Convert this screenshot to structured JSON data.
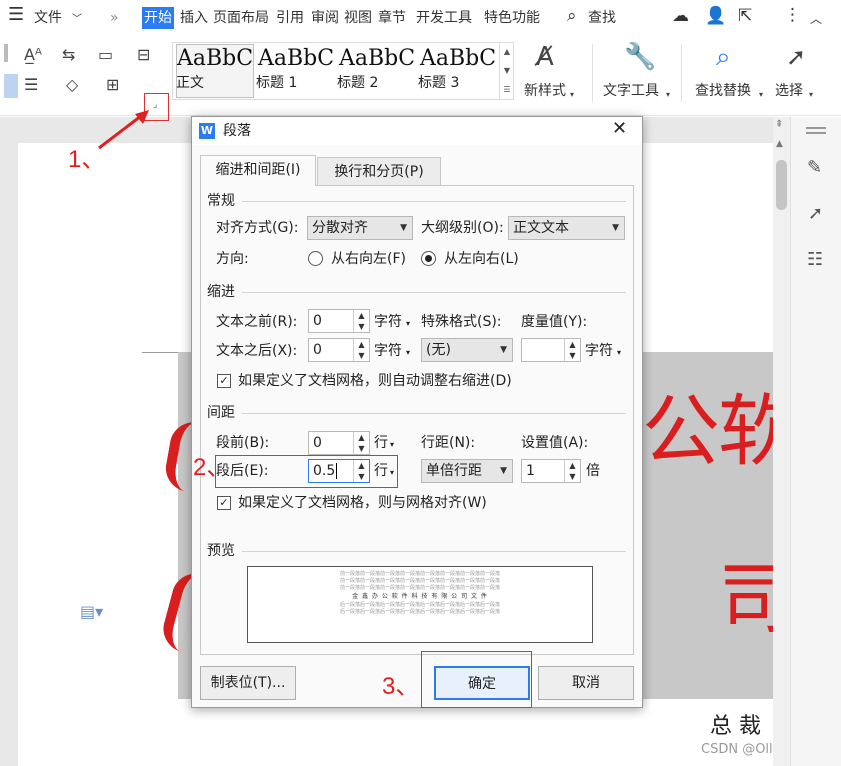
{
  "menubar": {
    "file": "文件",
    "tabs": [
      "开始",
      "插入",
      "页面布局",
      "引用",
      "审阅",
      "视图",
      "章节",
      "开发工具",
      "特色功能"
    ],
    "search": "查找"
  },
  "ribbon": {
    "styles": [
      {
        "sample": "AaBbC",
        "label": "正文"
      },
      {
        "sample": "AaBbC",
        "label": "标题 1"
      },
      {
        "sample": "AaBbC",
        "label": "标题 2"
      },
      {
        "sample": "AaBbC",
        "label": "标题 3"
      }
    ],
    "new_style": "新样式",
    "text_tools": "文字工具",
    "find_replace": "查找替换",
    "select": "选择"
  },
  "document": {
    "red_chars": [
      "软",
      "公",
      "司"
    ],
    "signature": "总 裁",
    "watermark": "CSDN @Oll Correct"
  },
  "dialog": {
    "title": "段落",
    "tabs": [
      "缩进和间距(I)",
      "换行和分页(P)"
    ],
    "general": {
      "heading": "常规",
      "align_label": "对齐方式(G):",
      "align_value": "分散对齐",
      "outline_label": "大纲级别(O):",
      "outline_value": "正文文本",
      "direction_label": "方向:",
      "rtl_label": "从右向左(F)",
      "ltr_label": "从左向右(L)"
    },
    "indent": {
      "heading": "缩进",
      "before_label": "文本之前(R):",
      "before_value": "0",
      "after_label": "文本之后(X):",
      "after_value": "0",
      "unit": "字符",
      "special_label": "特殊格式(S):",
      "special_value": "(无)",
      "measure_label": "度量值(Y):",
      "measure_unit": "字符",
      "auto_adjust": "如果定义了文档网格，则自动调整右缩进(D)"
    },
    "spacing": {
      "heading": "间距",
      "before_label": "段前(B):",
      "before_value": "0",
      "after_label": "段后(E):",
      "after_value": "0.5",
      "unit": "行",
      "line_label": "行距(N):",
      "line_value": "单倍行距",
      "set_label": "设置值(A):",
      "set_value": "1",
      "set_unit": "倍",
      "grid_align": "如果定义了文档网格，则与网格对齐(W)"
    },
    "preview": {
      "heading": "预览",
      "line_before": "前一段落前一段落前一段落前一段落前一段落前一段落前一段落前一段落",
      "line_main": "金 鑫 办 公 软 件 科 技 有 限 公 司 文 件",
      "line_after": "后一段落后一段落后一段落后一段落后一段落后一段落后一段落后一段落"
    },
    "buttons": {
      "tabs": "制表位(T)...",
      "ok": "确定",
      "cancel": "取消"
    }
  },
  "annotations": {
    "step1": "1、",
    "step2": "2、",
    "step3": "3、"
  },
  "colors": {
    "accent": "#2b7cf0",
    "annotation": "#e02020",
    "red_text": "#d81e1e"
  }
}
